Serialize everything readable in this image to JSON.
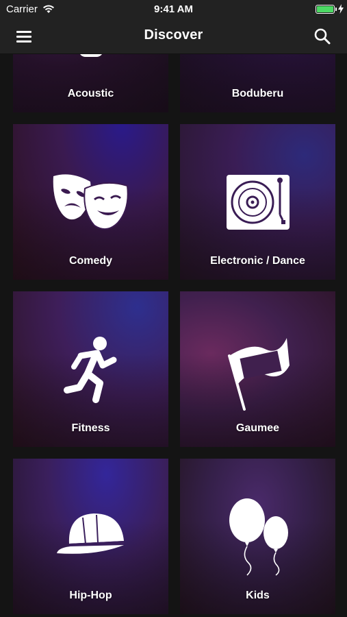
{
  "status_bar": {
    "carrier": "Carrier",
    "time": "9:41 AM"
  },
  "nav": {
    "title": "Discover",
    "menu_icon": "hamburger-menu-icon",
    "search_icon": "search-icon"
  },
  "genres": [
    {
      "label": "Acoustic",
      "icon": "guitar-icon"
    },
    {
      "label": "Boduberu",
      "icon": "drum-icon"
    },
    {
      "label": "Comedy",
      "icon": "theater-masks-icon"
    },
    {
      "label": "Electronic / Dance",
      "icon": "turntable-icon"
    },
    {
      "label": "Fitness",
      "icon": "runner-icon"
    },
    {
      "label": "Gaumee",
      "icon": "flag-icon"
    },
    {
      "label": "Hip-Hop",
      "icon": "cap-icon"
    },
    {
      "label": "Kids",
      "icon": "balloons-icon"
    }
  ],
  "colors": {
    "background": "#141414",
    "bar": "#222222",
    "battery": "#4cd964"
  }
}
